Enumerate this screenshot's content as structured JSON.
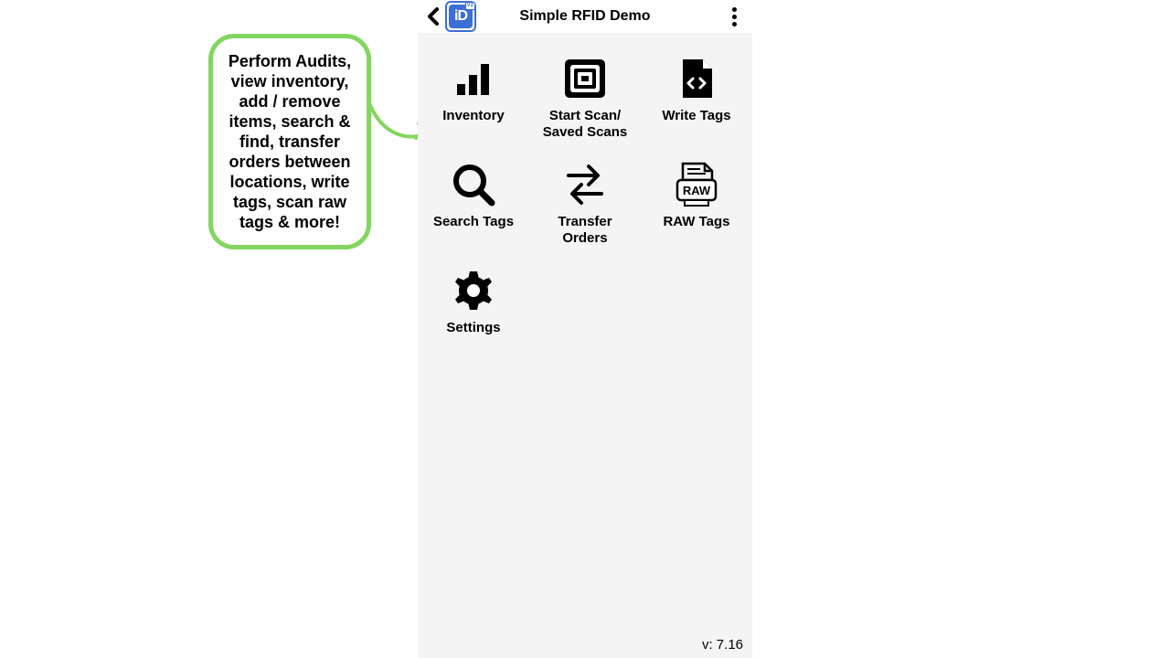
{
  "callout": {
    "text": "Perform Audits, view inventory, add / remove items, search & find, transfer orders between locations, write tags, scan raw tags & more!"
  },
  "header": {
    "title": "Simple RFID Demo",
    "logo_text": "iD",
    "logo_badge": "V2"
  },
  "menu": {
    "items": [
      {
        "id": "inventory",
        "label": "Inventory",
        "icon": "bars-icon"
      },
      {
        "id": "start-scan",
        "label": "Start Scan/\nSaved Scans",
        "icon": "scan-icon"
      },
      {
        "id": "write-tags",
        "label": "Write Tags",
        "icon": "file-code-icon"
      },
      {
        "id": "search-tags",
        "label": "Search Tags",
        "icon": "search-icon"
      },
      {
        "id": "transfer",
        "label": "Transfer\nOrders",
        "icon": "transfer-icon"
      },
      {
        "id": "raw-tags",
        "label": "RAW Tags",
        "icon": "raw-printer-icon",
        "badge_text": "RAW"
      },
      {
        "id": "settings",
        "label": "Settings",
        "icon": "gear-icon"
      }
    ]
  },
  "footer": {
    "version": "v: 7.16"
  }
}
